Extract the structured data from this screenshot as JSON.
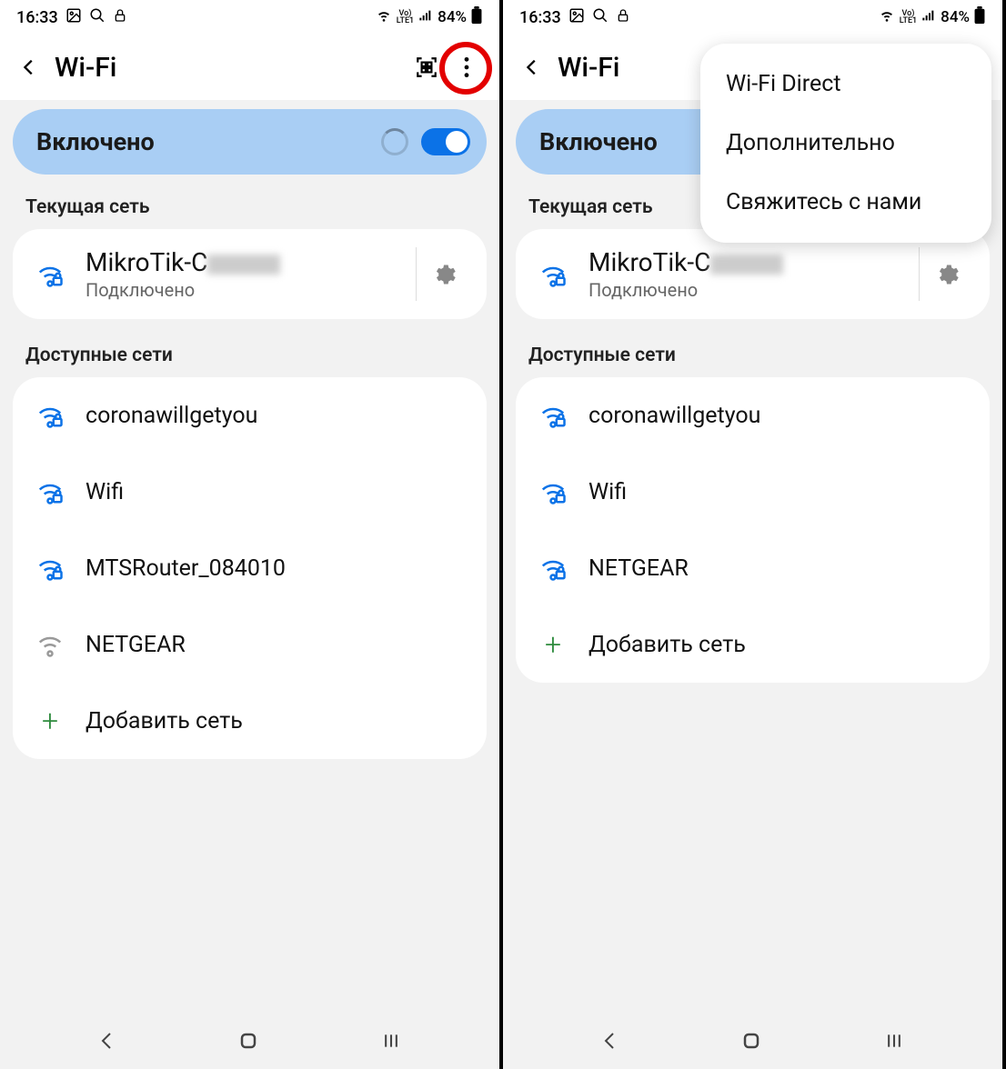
{
  "status": {
    "time": "16:33",
    "battery": "84%"
  },
  "header": {
    "title": "Wi-Fi"
  },
  "toggle": {
    "label": "Включено"
  },
  "sections": {
    "current": "Текущая сеть",
    "available": "Доступные сети"
  },
  "current_network": {
    "name": "MikroTik-C",
    "status": "Подключено"
  },
  "left_networks": [
    {
      "name": "coronawillgetyou",
      "secured": true
    },
    {
      "name": "Wifi",
      "secured": true
    },
    {
      "name": "MTSRouter_084010",
      "secured": true
    },
    {
      "name": "NETGEAR",
      "secured": false
    }
  ],
  "right_networks": [
    {
      "name": "coronawillgetyou",
      "secured": true
    },
    {
      "name": "Wifi",
      "secured": true
    },
    {
      "name": "NETGEAR",
      "secured": true
    }
  ],
  "add_label": "Добавить сеть",
  "popup": {
    "items": [
      "Wi-Fi Direct",
      "Дополнительно",
      "Свяжитесь с нами"
    ]
  }
}
